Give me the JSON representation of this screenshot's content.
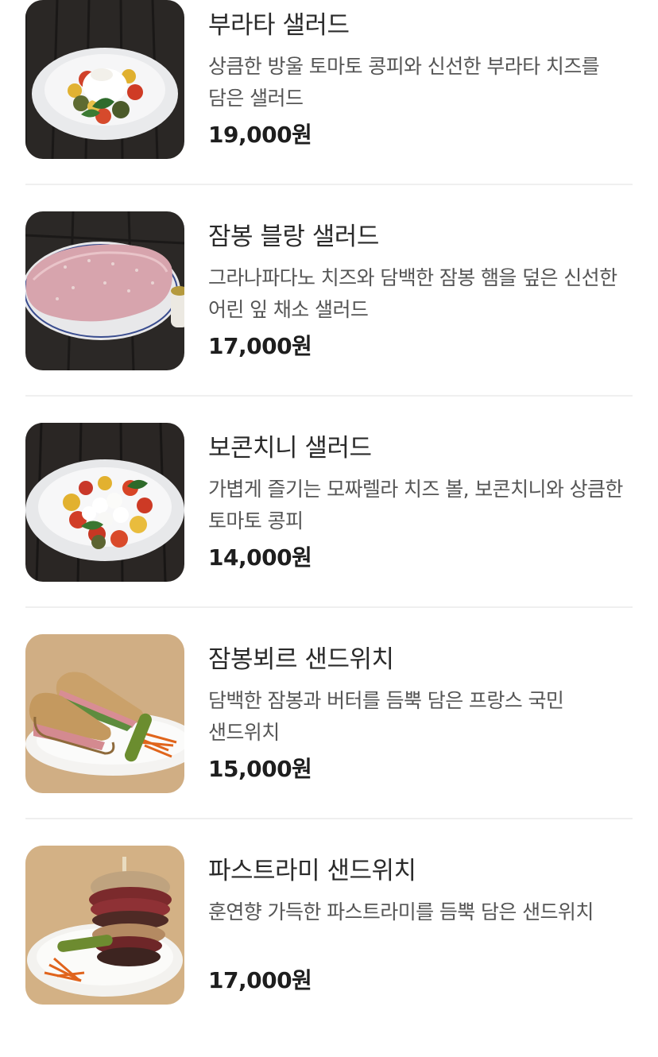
{
  "menu": {
    "items": [
      {
        "name": "부라타 샐러드",
        "description": "상큼한 방울 토마토 콩피와 신선한 부라타 치즈를 담은 샐러드",
        "price": "19,000원",
        "image_icon": "burrata-salad-photo"
      },
      {
        "name": "잠봉 블랑 샐러드",
        "description": "그라나파다노 치즈와 담백한 잠봉 햄을 덮은 신선한 어린 잎 채소 샐러드",
        "price": "17,000원",
        "image_icon": "jambon-blanc-salad-photo"
      },
      {
        "name": "보콘치니 샐러드",
        "description": "가볍게 즐기는 모짜렐라 치즈 볼, 보콘치니와 상큼한 토마토 콩피",
        "price": "14,000원",
        "image_icon": "bocconcini-salad-photo"
      },
      {
        "name": "잠봉뵈르 샌드위치",
        "description": "담백한 잠봉과 버터를 듬뿍 담은 프랑스 국민 샌드위치",
        "price": "15,000원",
        "image_icon": "jambon-beurre-sandwich-photo"
      },
      {
        "name": "파스트라미 샌드위치",
        "description": "훈연향 가득한 파스트라미를 듬뿍 담은 샌드위치",
        "price": "17,000원",
        "image_icon": "pastrami-sandwich-photo"
      }
    ]
  }
}
